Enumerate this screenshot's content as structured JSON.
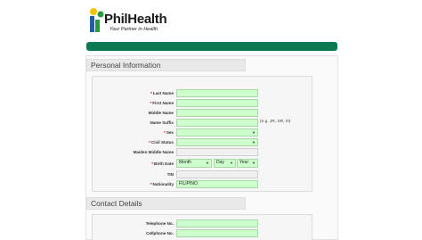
{
  "brand": {
    "name": "PhilHealth",
    "tagline": "Your Partner in Health",
    "colors": {
      "accent": "#0b7a52",
      "field": "#ccffcc",
      "required": "#dd0000"
    }
  },
  "personal_section": {
    "title": "Personal Information",
    "fields": {
      "last_name": {
        "label": "Last Name",
        "required": true,
        "value": ""
      },
      "first_name": {
        "label": "First Name",
        "required": true,
        "value": ""
      },
      "middle_name": {
        "label": "Middle Name",
        "required": false,
        "value": ""
      },
      "name_suffix": {
        "label": "Name Suffix",
        "required": false,
        "value": "",
        "hint": "(e.g. JR, SR, III)"
      },
      "sex": {
        "label": "Sex",
        "required": true,
        "value": ""
      },
      "civil_status": {
        "label": "Civil Status",
        "required": true,
        "value": ""
      },
      "maiden_middle_name": {
        "label": "Maiden Middle Name",
        "required": false,
        "value": ""
      },
      "birth_date": {
        "label": "Birth Date",
        "required": true,
        "month": "Month",
        "day": "Day",
        "year": "Year"
      },
      "tin": {
        "label": "TIN",
        "required": false,
        "value": ""
      },
      "nationality": {
        "label": "Nationality",
        "required": true,
        "value": "FILIPINO"
      }
    }
  },
  "contact_section": {
    "title": "Contact Details",
    "fields": {
      "telephone": {
        "label": "Telephone No.",
        "value": ""
      },
      "cellphone": {
        "label": "Cellphone No.",
        "value": ""
      }
    }
  }
}
